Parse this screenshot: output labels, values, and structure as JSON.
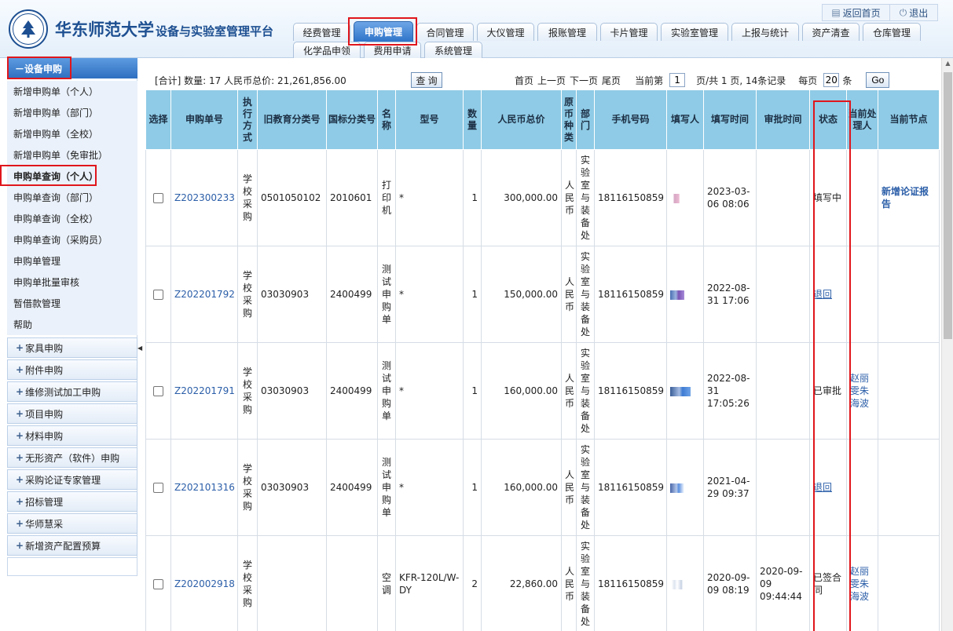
{
  "header": {
    "university": "华东师范大学",
    "platform": "设备与实验室管理平台",
    "home_link": "返回首页",
    "exit_link": "退出"
  },
  "nav_tabs": [
    "经费管理",
    "申购管理",
    "合同管理",
    "大仪管理",
    "报账管理",
    "卡片管理",
    "实验室管理",
    "上报与统计",
    "资产清查",
    "仓库管理",
    "化学品申领",
    "费用申请",
    "系统管理"
  ],
  "sidebar": {
    "section_title": "－设备申购",
    "items": [
      "新增申购单（个人）",
      "新增申购单（部门）",
      "新增申购单（全校）",
      "新增申购单（免审批）",
      "申购单查询（个人）",
      "申购单查询（部门）",
      "申购单查询（全校）",
      "申购单查询（采购员）",
      "申购单管理",
      "申购单批量审核",
      "暂借款管理",
      "帮助"
    ],
    "groups": [
      "家具申购",
      "附件申购",
      "维修测试加工申购",
      "项目申购",
      "材料申购",
      "无形资产（软件）申购",
      "采购论证专家管理",
      "招标管理",
      "华师慧采",
      "新增资产配置预算"
    ]
  },
  "toolbar": {
    "summary": "[合计] 数量: 17  人民币总价: 21,261,856.00",
    "query_btn": "查 询",
    "first": "首页",
    "prev": "上一页",
    "next": "下一页",
    "last": "尾页",
    "current_label": "当前第",
    "current_page": "1",
    "pages_text": "页/共  1  页, 14条记录",
    "per_page_label": "每页",
    "per_page": "20",
    "per_page_unit": "条",
    "go": "Go"
  },
  "table": {
    "headers": {
      "select": "选择",
      "order_no": "申购单号",
      "exec": "执行方式",
      "old_code": "旧教育分类号",
      "nat_code": "国标分类号",
      "name": "名称",
      "model": "型号",
      "qty": "数量",
      "price": "人民币总价",
      "currency": "原币种类",
      "dept": "部门",
      "phone": "手机号码",
      "filler": "填写人",
      "fill_time": "填写时间",
      "approve_time": "审批时间",
      "status": "状态",
      "handler": "当前处理人",
      "node": "当前节点"
    },
    "rows": [
      {
        "order_no": "Z202300233",
        "exec": "学校采购",
        "old_code": "0501050102",
        "nat_code": "2010601",
        "name": "打印机",
        "model": "*",
        "qty": "1",
        "price": "300,000.00",
        "currency": "人民币",
        "dept": "实验室与装备处",
        "phone": "18116150859",
        "fill_time": "2023-03-06 08:06",
        "approve_time": "",
        "status": "填写中",
        "handler": "",
        "node": "新增论证报告"
      },
      {
        "order_no": "Z202201792",
        "exec": "学校采购",
        "old_code": "03030903",
        "nat_code": "2400499",
        "name": "测试申购单",
        "model": "*",
        "qty": "1",
        "price": "150,000.00",
        "currency": "人民币",
        "dept": "实验室与装备处",
        "phone": "18116150859",
        "fill_time": "2022-08-31 17:06",
        "approve_time": "",
        "status": "退回",
        "handler": "",
        "node": ""
      },
      {
        "order_no": "Z202201791",
        "exec": "学校采购",
        "old_code": "03030903",
        "nat_code": "2400499",
        "name": "测试申购单",
        "model": "*",
        "qty": "1",
        "price": "160,000.00",
        "currency": "人民币",
        "dept": "实验室与装备处",
        "phone": "18116150859",
        "fill_time": "2022-08-31 17:05:26",
        "approve_time": "",
        "status": "已审批",
        "handler": "赵丽雯朱海波",
        "node": ""
      },
      {
        "order_no": "Z202101316",
        "exec": "学校采购",
        "old_code": "03030903",
        "nat_code": "2400499",
        "name": "测试申购单",
        "model": "*",
        "qty": "1",
        "price": "160,000.00",
        "currency": "人民币",
        "dept": "实验室与装备处",
        "phone": "18116150859",
        "fill_time": "2021-04-29 09:37",
        "approve_time": "",
        "status": "退回",
        "handler": "",
        "node": ""
      },
      {
        "order_no": "Z202002918",
        "exec": "学校采购",
        "old_code": "",
        "nat_code": "",
        "name": "空调",
        "model": "KFR-120L/W-DY",
        "qty": "2",
        "price": "22,860.00",
        "currency": "人民币",
        "dept": "实验室与装备处",
        "phone": "18116150859",
        "fill_time": "2020-09-09 08:19",
        "approve_time": "2020-09-09 09:44:44",
        "status": "已签合同",
        "handler": "赵丽雯朱海波",
        "node": ""
      }
    ]
  }
}
